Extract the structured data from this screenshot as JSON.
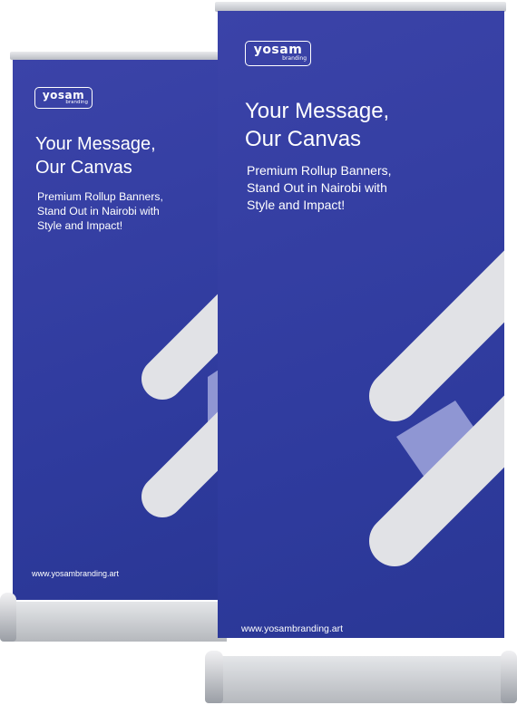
{
  "colors": {
    "panel": "#3039a0",
    "shape": "#e1e2e6",
    "connector": "#8f96d3",
    "metal": "#c8cbd0"
  },
  "banners": [
    {
      "logo_main": "yosam",
      "logo_sub": "branding",
      "headline_line1": "Your Message,",
      "headline_line2": "Our Canvas",
      "sub_line1": "Premium Rollup Banners,",
      "sub_line2": "Stand Out in Nairobi with",
      "sub_line3": "Style and Impact!",
      "url": "www.yosambranding.art"
    },
    {
      "logo_main": "yosam",
      "logo_sub": "branding",
      "headline_line1": "Your Message,",
      "headline_line2": "Our Canvas",
      "sub_line1": "Premium Rollup Banners,",
      "sub_line2": "Stand Out in Nairobi with",
      "sub_line3": "Style and Impact!",
      "url": "www.yosambranding.art"
    }
  ]
}
